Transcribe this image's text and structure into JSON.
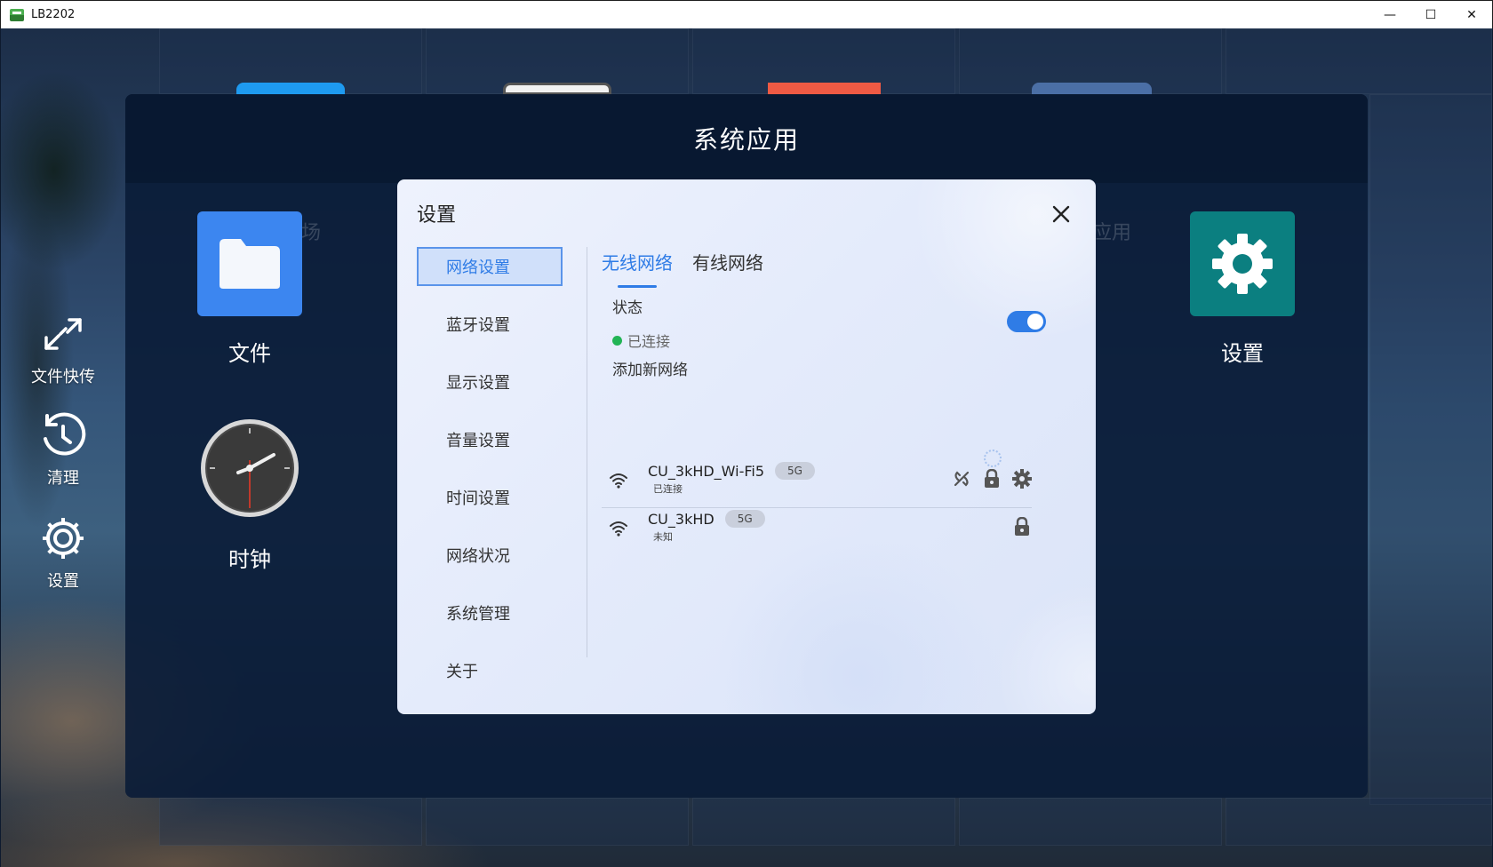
{
  "window": {
    "title": "LB2202",
    "minimize": "—",
    "maximize": "☐",
    "close": "✕"
  },
  "dock": [
    {
      "name": "file-transfer",
      "label": "文件快传"
    },
    {
      "name": "clean",
      "label": "清理"
    },
    {
      "name": "settings",
      "label": "设置"
    }
  ],
  "apps_panel": {
    "title": "系统应用",
    "apps": [
      {
        "name": "files",
        "label": "文件",
        "color": "#3c86f0"
      },
      {
        "name": "clock",
        "label": "时钟"
      },
      {
        "name": "settings",
        "label": "设置",
        "color": "#0b7f80"
      }
    ],
    "ghost_left": "场",
    "ghost_right": "应用"
  },
  "dialog": {
    "title": "设置",
    "menu": [
      {
        "label": "网络设置",
        "active": true
      },
      {
        "label": "蓝牙设置"
      },
      {
        "label": "显示设置"
      },
      {
        "label": "音量设置"
      },
      {
        "label": "时间设置"
      },
      {
        "label": "网络状况"
      },
      {
        "label": "系统管理"
      },
      {
        "label": "关于"
      }
    ],
    "tabs": [
      {
        "label": "无线网络",
        "active": true
      },
      {
        "label": "有线网络"
      }
    ],
    "status": {
      "label": "状态",
      "value": "已连接",
      "toggle_on": true,
      "accent": "#2f7ce6",
      "dot_color": "#22b455"
    },
    "add_network": "添加新网络",
    "networks": [
      {
        "ssid": "CU_3kHD_Wi-Fi5",
        "band": "5G",
        "state": "已连接",
        "icons": [
          "disconnect-icon",
          "lock-icon",
          "gear-icon"
        ]
      },
      {
        "ssid": "CU_3kHD",
        "band": "5G",
        "state": "未知",
        "icons": [
          "lock-icon"
        ]
      }
    ]
  }
}
